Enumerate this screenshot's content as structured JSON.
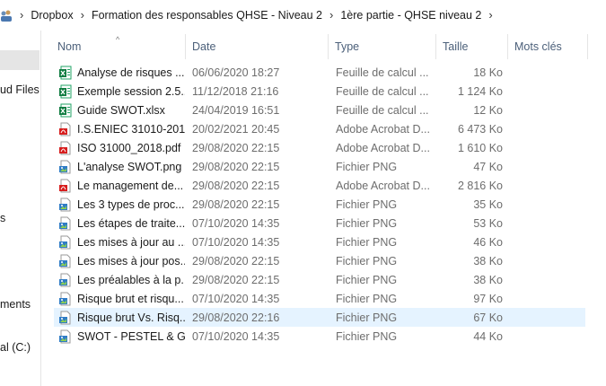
{
  "breadcrumb": [
    "Dropbox",
    "Formation des responsables QHSE - Niveau 2",
    "1ère partie - QHSE niveau 2"
  ],
  "nav": {
    "items": [
      "ud Files",
      "s",
      "ments",
      "al (C:)"
    ]
  },
  "columns": {
    "name": "Nom",
    "date": "Date",
    "type": "Type",
    "size": "Taille",
    "tags": "Mots clés"
  },
  "files": [
    {
      "name": "Analyse de risques ...",
      "date": "06/06/2020 18:27",
      "type": "Feuille de calcul ...",
      "size": "18 Ko",
      "icon": "excel-icon"
    },
    {
      "name": "Exemple session 2.5...",
      "date": "11/12/2018 21:16",
      "type": "Feuille de calcul ...",
      "size": "1 124 Ko",
      "icon": "excel-icon"
    },
    {
      "name": "Guide SWOT.xlsx",
      "date": "24/04/2019 16:51",
      "type": "Feuille de calcul ...",
      "size": "12 Ko",
      "icon": "excel-icon"
    },
    {
      "name": "I.S.ENIEC 31010-201...",
      "date": "20/02/2021 20:45",
      "type": "Adobe Acrobat D...",
      "size": "6 473 Ko",
      "icon": "pdf-icon"
    },
    {
      "name": "ISO 31000_2018.pdf",
      "date": "29/08/2020 22:15",
      "type": "Adobe Acrobat D...",
      "size": "1 610 Ko",
      "icon": "pdf-icon"
    },
    {
      "name": "L'analyse SWOT.png",
      "date": "29/08/2020 22:15",
      "type": "Fichier PNG",
      "size": "47 Ko",
      "icon": "png-icon"
    },
    {
      "name": "Le management de...",
      "date": "29/08/2020 22:15",
      "type": "Adobe Acrobat D...",
      "size": "2 816 Ko",
      "icon": "pdf-icon"
    },
    {
      "name": "Les 3 types de proc...",
      "date": "29/08/2020 22:15",
      "type": "Fichier PNG",
      "size": "35 Ko",
      "icon": "png-icon"
    },
    {
      "name": "Les étapes de traite...",
      "date": "07/10/2020 14:35",
      "type": "Fichier PNG",
      "size": "53 Ko",
      "icon": "png-icon"
    },
    {
      "name": "Les mises à jour au ...",
      "date": "07/10/2020 14:35",
      "type": "Fichier PNG",
      "size": "46 Ko",
      "icon": "png-icon"
    },
    {
      "name": "Les mises à jour pos...",
      "date": "29/08/2020 22:15",
      "type": "Fichier PNG",
      "size": "38 Ko",
      "icon": "png-icon"
    },
    {
      "name": "Les préalables à la p...",
      "date": "29/08/2020 22:15",
      "type": "Fichier PNG",
      "size": "38 Ko",
      "icon": "png-icon"
    },
    {
      "name": "Risque brut et risqu...",
      "date": "07/10/2020 14:35",
      "type": "Fichier PNG",
      "size": "97 Ko",
      "icon": "png-icon"
    },
    {
      "name": "Risque brut Vs. Risq...",
      "date": "29/08/2020 22:16",
      "type": "Fichier PNG",
      "size": "67 Ko",
      "icon": "png-icon",
      "selected": true
    },
    {
      "name": "SWOT - PESTEL & G...",
      "date": "07/10/2020 14:35",
      "type": "Fichier PNG",
      "size": "44 Ko",
      "icon": "png-icon"
    }
  ],
  "colors": {
    "selection": "#e5f3ff",
    "header_text": "#4c607a",
    "meta_text": "#6d6d6d"
  }
}
